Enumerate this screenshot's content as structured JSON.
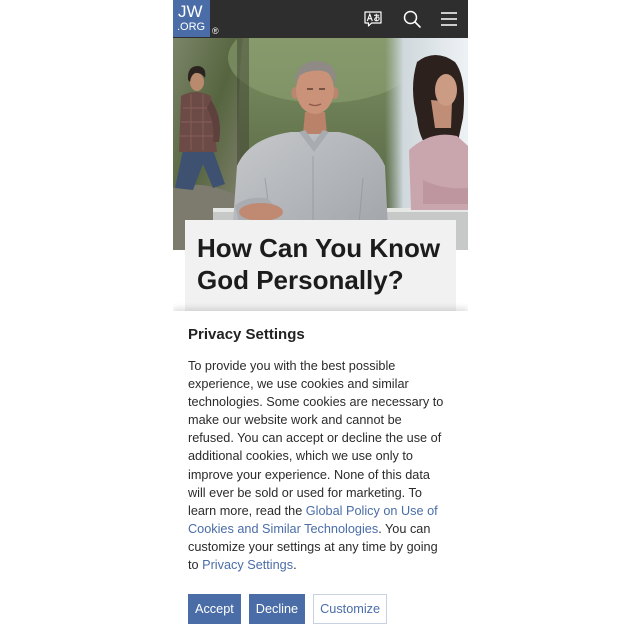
{
  "header": {
    "logo": {
      "jw": "JW",
      "org": ".ORG",
      "registered": "®"
    },
    "icons": {
      "language": "language-icon",
      "search": "search-icon",
      "menu": "menu-icon"
    }
  },
  "article": {
    "title": "How Can You Know God Personally?"
  },
  "privacy": {
    "title": "Privacy Settings",
    "text_before_policy": "To provide you with the best possible experience, we use cookies and similar technologies. Some cookies are necessary to make our website work and cannot be refused. You can accept or decline the use of additional cookies, which we use only to improve your experience. None of this data will ever be sold or used for marketing. To learn more, read the ",
    "policy_link": "Global Policy on Use of Cookies and Similar Technologies",
    "text_before_settings": ". You can customize your settings at any time by going to ",
    "settings_link": "Privacy Settings",
    "text_end": ".",
    "buttons": {
      "accept": "Accept",
      "decline": "Decline",
      "customize": "Customize"
    }
  },
  "colors": {
    "header_bg": "#2e2e2e",
    "brand_blue": "#4a6da7",
    "text": "#2b2b2b"
  }
}
